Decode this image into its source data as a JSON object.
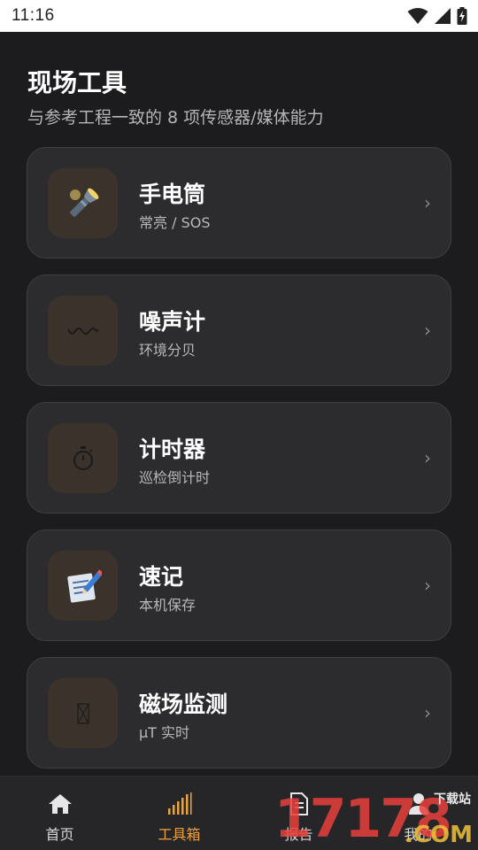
{
  "status_bar": {
    "time": "11:16"
  },
  "header": {
    "title": "现场工具",
    "subtitle": "与参考工程一致的 8 项传感器/媒体能力"
  },
  "tools": [
    {
      "title": "手电筒",
      "subtitle": "常亮 / SOS",
      "icon": "flashlight-icon",
      "chevron": "›"
    },
    {
      "title": "噪声计",
      "subtitle": "环境分贝",
      "icon": "wave-icon",
      "chevron": "›"
    },
    {
      "title": "计时器",
      "subtitle": "巡检倒计时",
      "icon": "stopwatch-icon",
      "chevron": "›"
    },
    {
      "title": "速记",
      "subtitle": "本机保存",
      "icon": "memo-icon",
      "chevron": "›"
    },
    {
      "title": "磁场监测",
      "subtitle": "μT 实时",
      "icon": "compass-icon",
      "chevron": "›"
    }
  ],
  "bottom_nav": {
    "items": [
      {
        "label": "首页",
        "icon": "home-icon",
        "active": false
      },
      {
        "label": "工具箱",
        "icon": "signal-bars-icon",
        "active": true
      },
      {
        "label": "报告",
        "icon": "document-icon",
        "active": false
      },
      {
        "label": "我的",
        "icon": "person-icon",
        "active": false
      }
    ]
  },
  "watermark": {
    "number": "17178",
    "domain": ".COM",
    "text": "下载站"
  },
  "colors": {
    "background": "#1c1c1e",
    "card": "#2c2c2f",
    "icon_box": "#3b332b",
    "accent": "#f0a23a"
  }
}
